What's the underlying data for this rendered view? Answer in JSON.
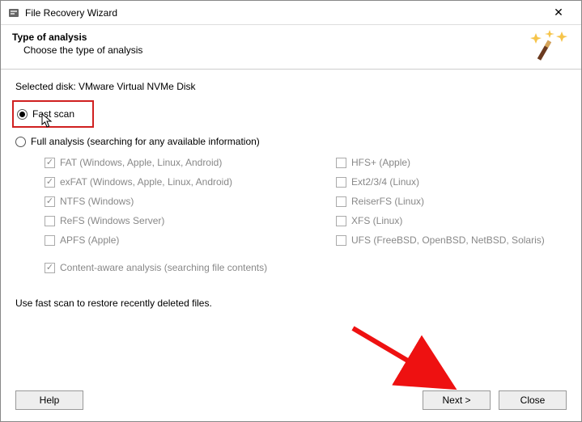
{
  "window": {
    "title": "File Recovery Wizard",
    "close_glyph": "✕"
  },
  "header": {
    "title": "Type of analysis",
    "subtitle": "Choose the type of analysis"
  },
  "selected_disk_label": "Selected disk: VMware Virtual NVMe Disk",
  "options": {
    "fast_label": "Fast scan",
    "full_label": "Full analysis (searching for any available information)"
  },
  "filesystems_left": [
    {
      "label": "FAT (Windows, Apple, Linux, Android)",
      "checked": true
    },
    {
      "label": "exFAT (Windows, Apple, Linux, Android)",
      "checked": true
    },
    {
      "label": "NTFS (Windows)",
      "checked": true
    },
    {
      "label": "ReFS (Windows Server)",
      "checked": false
    },
    {
      "label": "APFS (Apple)",
      "checked": false
    }
  ],
  "filesystems_right": [
    {
      "label": "HFS+ (Apple)",
      "checked": false
    },
    {
      "label": "Ext2/3/4 (Linux)",
      "checked": false
    },
    {
      "label": "ReiserFS (Linux)",
      "checked": false
    },
    {
      "label": "XFS (Linux)",
      "checked": false
    },
    {
      "label": "UFS (FreeBSD, OpenBSD, NetBSD, Solaris)",
      "checked": false
    }
  ],
  "content_aware_label": "Content-aware analysis (searching file contents)",
  "content_aware_checked": true,
  "hint_text": "Use fast scan to restore recently deleted files.",
  "buttons": {
    "help": "Help",
    "next": "Next >",
    "close": "Close"
  }
}
